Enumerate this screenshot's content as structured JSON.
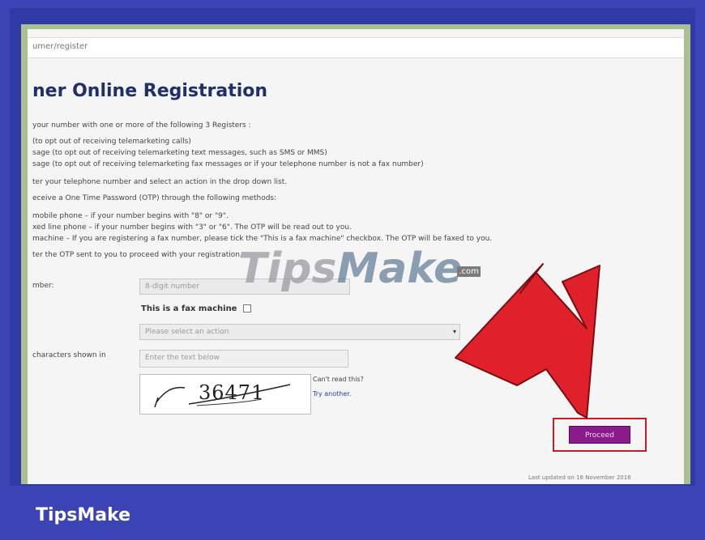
{
  "browser": {
    "url": "umer/register"
  },
  "page": {
    "title": "ner Online Registration",
    "intro": "your number with one or more of the following 3 Registers :",
    "registers": [
      "(to opt out of receiving telemarketing calls)",
      "sage (to opt out of receiving telemarketing text messages, such as SMS or MMS)",
      "sage (to opt out of receiving telemarketing fax messages or if your telephone number is not a fax number)"
    ],
    "step1": "ter your telephone number and select an action in the drop down list.",
    "step2": "eceive a One Time Password (OTP) through the following methods:",
    "methods": [
      "mobile phone – if your number begins with \"8\" or \"9\".",
      "xed line phone – if your number begins with \"3\" or \"6\". The OTP will be read out to you.",
      "machine – If you are registering a fax number, please tick the \"This is a fax machine\" checkbox. The OTP will be faxed to you."
    ],
    "step3": "ter the OTP sent to you to proceed with your registration."
  },
  "form": {
    "number_label": "mber:",
    "number_placeholder": "8-digit number",
    "fax_label": "This is a fax machine",
    "action_placeholder": "Please select an action",
    "captcha_label": "characters shown in",
    "captcha_placeholder": "Enter the text below",
    "captcha_value": "36471",
    "cant_read": "Can't read this?",
    "try_another": "Try another.",
    "proceed": "Proceed"
  },
  "footer": {
    "last_updated": "Last updated on 16 November 2016"
  },
  "watermark": {
    "main": "Tips",
    "main2": "Make",
    "suffix": ".com"
  },
  "brand": "TipsMake",
  "colors": {
    "arrow": "#e0212b",
    "highlight": "#c81d25",
    "button": "#8b1a8b",
    "background": "#3b43b5"
  }
}
